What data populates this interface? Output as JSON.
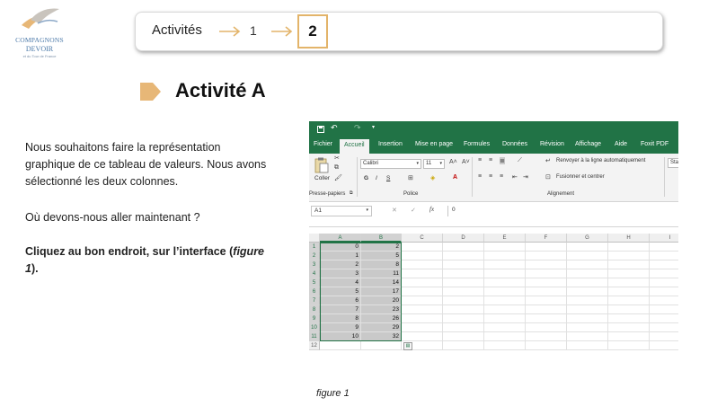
{
  "logo": {
    "line1": "COMPAGNONS",
    "line2": "DEVOIR",
    "line3": "et du Tour de France"
  },
  "breadcrumb": {
    "root": "Activités",
    "step1": "1",
    "step2": "2"
  },
  "heading": "Activité A",
  "paragraphs": {
    "p1": "Nous souhaitons faire la représentation graphique de ce tableau de valeurs. Nous avons sélectionné les deux colonnes.",
    "p2": "Où devons-nous aller maintenant ?",
    "p3_a": "Cliquez au bon endroit, sur l’interface (",
    "p3_b": "figure 1",
    "p3_c": ")."
  },
  "excel": {
    "tabs": [
      "Fichier",
      "Accueil",
      "Insertion",
      "Mise en page",
      "Formules",
      "Données",
      "Révision",
      "Affichage",
      "Aide",
      "Foxit PDF"
    ],
    "active_tab": "Accueil",
    "ribbon": {
      "paste": "Coller",
      "font_name": "Calibri",
      "font_size": "11",
      "bold": "G",
      "italic": "I",
      "underline": "S",
      "wrap": "Renvoyer à la ligne automatiquement",
      "merge": "Fusionner et centrer",
      "style_box": "Sta",
      "groups": [
        "Presse-papiers",
        "Police",
        "Alignement"
      ]
    },
    "namebox": "A1",
    "fx": "fx",
    "formula_value": "0",
    "columns": [
      "A",
      "B",
      "C",
      "D",
      "E",
      "F",
      "G",
      "H",
      "I"
    ],
    "rows": [
      "1",
      "2",
      "3",
      "4",
      "5",
      "6",
      "7",
      "8",
      "9",
      "10",
      "11",
      "12"
    ],
    "colA": [
      "0",
      "1",
      "2",
      "3",
      "4",
      "5",
      "6",
      "7",
      "8",
      "9",
      "10"
    ],
    "colB": [
      "2",
      "5",
      "8",
      "11",
      "14",
      "17",
      "20",
      "23",
      "26",
      "29",
      "32"
    ]
  },
  "caption": "figure 1",
  "colors": {
    "excel_green": "#217346",
    "accent": "#e3b46a"
  }
}
